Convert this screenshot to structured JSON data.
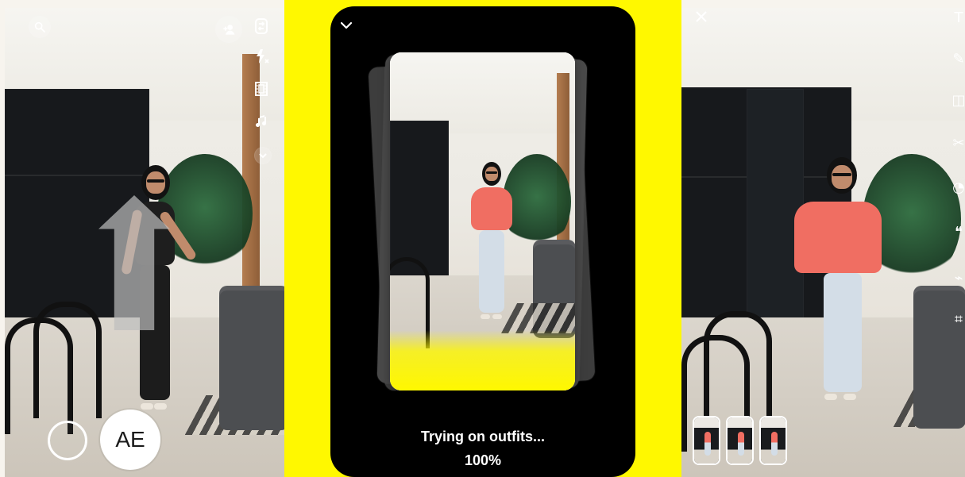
{
  "screen": {
    "left_avatar_initials": "AE",
    "center_status_text": "Trying on outfits...",
    "center_progress_text": "100%"
  },
  "icons": {
    "left_top": [
      "search-icon",
      "add-friend-icon",
      "flip-camera-icon",
      "flash-off-icon",
      "filmstrip-icon",
      "music-icon",
      "chevron-down-icon"
    ],
    "center_top": [
      "chevron-down-icon"
    ],
    "right_top": [
      "close-icon"
    ],
    "right_tools": [
      "text-icon",
      "draw-icon",
      "sticker-icon",
      "scissors-icon",
      "timer-icon",
      "quote-icon",
      "attach-icon",
      "crop-icon"
    ]
  },
  "colors": {
    "accent_yellow": "#fff800",
    "outfit_coral": "#f06e62",
    "jeans_light": "#d3dde7",
    "black_outfit": "#1e1e1e"
  },
  "thumbnails": {
    "count": 3
  }
}
